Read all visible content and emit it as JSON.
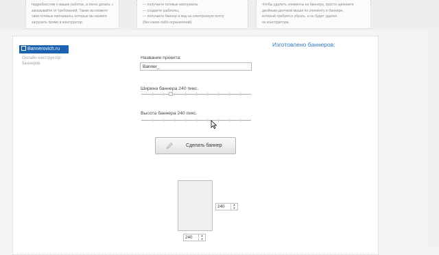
{
  "cards": [
    {
      "lines": [
        "подробностям о ваших работах, и легко делать, а",
        "заказывайте от требований. Также вы можете",
        "свои готовые материалы, которые вы можете",
        "загрузить прямо в конструктор."
      ]
    },
    {
      "lines": [
        "— получаете готовые материалы,",
        "— создаете шаблоны,",
        "— получаете баннер и код на электронную почту",
        "(без каких-либо ограничений)."
      ]
    },
    {
      "lines": [
        "Чтобы удалить элементы из баннера, просто щелкните",
        "двойным щелчком мыши по элементу в баннере,",
        "который требуется убрать, и он будет удален",
        "из конструктора."
      ]
    }
  ],
  "brand": {
    "logo_text": "Bannerovich.ru",
    "tagline": "Онлайн конструктор баннеров"
  },
  "made_title": "Изготовлено баннеров:",
  "form": {
    "project_label": "Название проекта:",
    "project_value": "Banner_",
    "width_label": "Ширина баннера 240 пикс.",
    "width_value_fraction": 0.27,
    "height_label": "Высота баннера 240 пикс.",
    "height_value_fraction": 0.66,
    "make_button_label": "Сделать баннер"
  },
  "preview": {
    "height_value": "240",
    "width_value": "240"
  },
  "icons": {
    "logo": "logo-square-icon",
    "button": "pencil-icon",
    "spin_up": "arrow-up-icon",
    "spin_down": "arrow-down-icon",
    "cursor": "mouse-cursor-icon"
  },
  "colors": {
    "brand_blue": "#1c62b3",
    "title_blue": "#2f78c2"
  }
}
